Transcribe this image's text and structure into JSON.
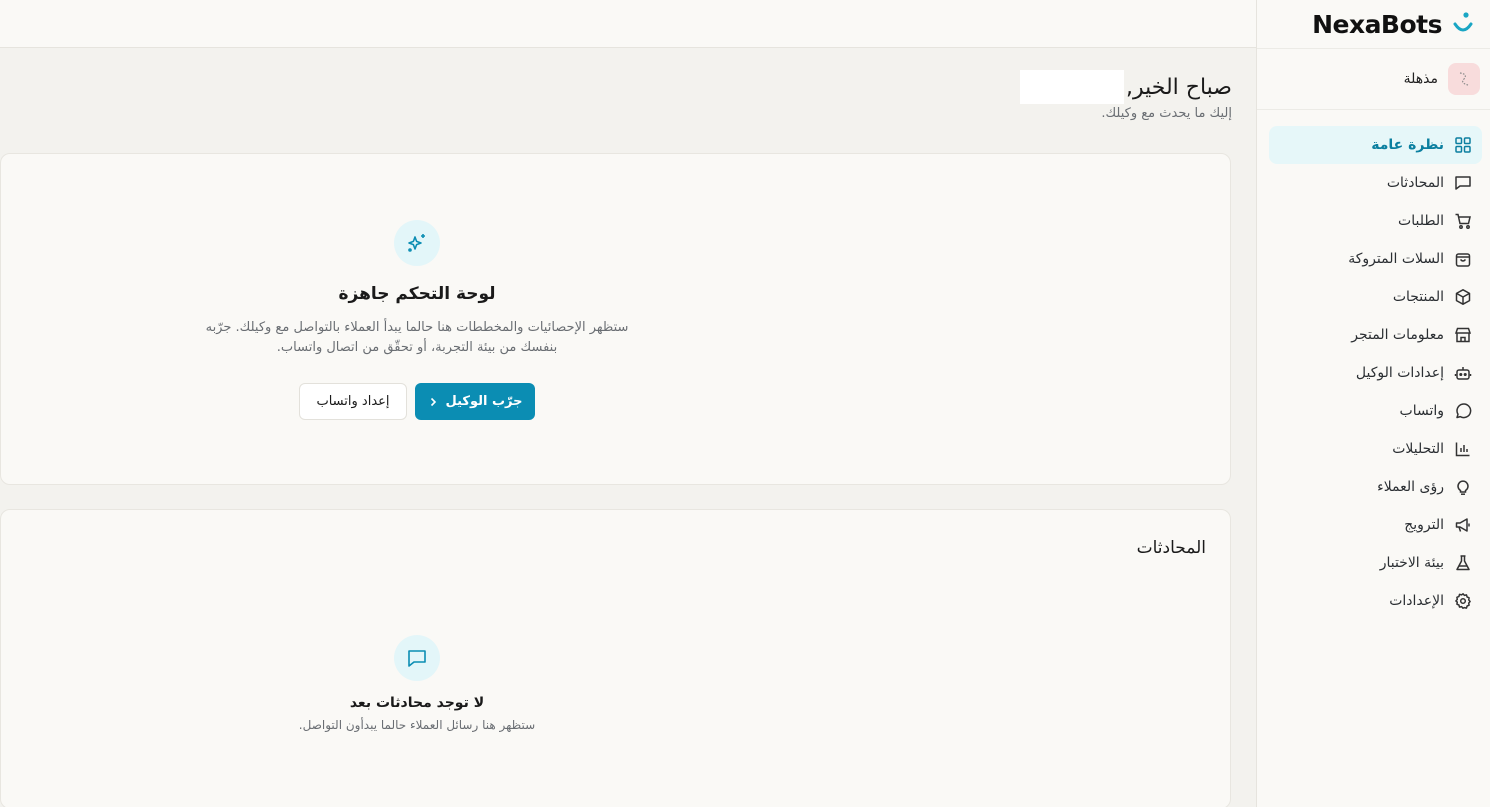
{
  "brand": {
    "name": "NexaBots",
    "accent": "#1aa6c4"
  },
  "store": {
    "name": "مذهلة"
  },
  "nav": {
    "items": [
      {
        "label": "نظرة عامة",
        "icon": "grid-icon",
        "active": true
      },
      {
        "label": "المحادثات",
        "icon": "chat-icon"
      },
      {
        "label": "الطلبات",
        "icon": "cart-icon"
      },
      {
        "label": "السلات المتروكة",
        "icon": "bag-icon"
      },
      {
        "label": "المنتجات",
        "icon": "box-icon"
      },
      {
        "label": "معلومات المتجر",
        "icon": "store-icon"
      },
      {
        "label": "إعدادات الوكيل",
        "icon": "bot-icon"
      },
      {
        "label": "واتساب",
        "icon": "whatsapp-icon"
      },
      {
        "label": "التحليلات",
        "icon": "bar-chart-icon"
      },
      {
        "label": "رؤى العملاء",
        "icon": "lightbulb-icon"
      },
      {
        "label": "الترويج",
        "icon": "megaphone-icon"
      },
      {
        "label": "بيئة الاختبار",
        "icon": "flask-icon"
      },
      {
        "label": "الإعدادات",
        "icon": "gear-icon"
      }
    ]
  },
  "greeting": {
    "title": "صباح الخير,",
    "subtitle": "إليك ما يحدث مع وكيلك."
  },
  "hero": {
    "title": "لوحة التحكم جاهزة",
    "description": "ستظهر الإحصائيات والمخططات هنا حالما يبدأ العملاء بالتواصل مع وكيلك. جرّبه بنفسك من بيئة التجربة، أو تحقّق من اتصال واتساب.",
    "primary_button": "جرّب الوكيل",
    "secondary_button": "إعداد واتساب"
  },
  "conversations": {
    "title": "المحادثات",
    "empty_title": "لا توجد محادثات بعد",
    "empty_description": "ستظهر هنا رسائل العملاء حالما يبدأون التواصل."
  }
}
